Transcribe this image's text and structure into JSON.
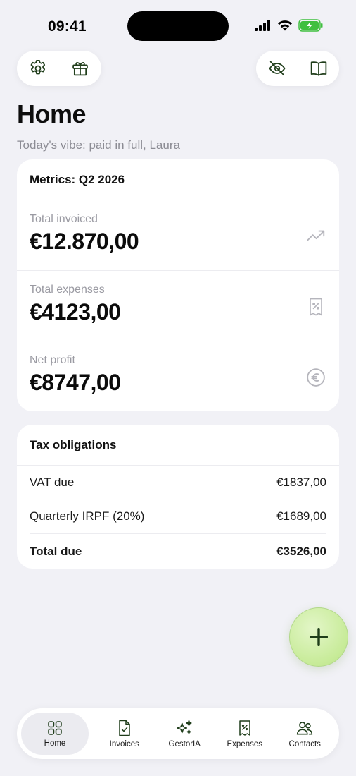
{
  "status_bar": {
    "time": "09:41"
  },
  "header": {
    "title": "Home",
    "subtitle": "Today's vibe: paid in full, Laura"
  },
  "icons": {
    "settings": "gear-icon",
    "gift": "gift-icon",
    "hide": "eye-off-icon",
    "guide": "book-open-icon"
  },
  "metrics": {
    "title": "Metrics: Q2 2026",
    "items": [
      {
        "label": "Total invoiced",
        "value": "€12.870,00",
        "icon": "trending-up-icon"
      },
      {
        "label": "Total expenses",
        "value": "€4123,00",
        "icon": "receipt-percent-icon"
      },
      {
        "label": "Net profit",
        "value": "€8747,00",
        "icon": "euro-circle-icon"
      }
    ]
  },
  "tax": {
    "title": "Tax obligations",
    "rows": [
      {
        "label": "VAT due",
        "value": "€1837,00"
      },
      {
        "label": "Quarterly IRPF (20%)",
        "value": "€1689,00"
      }
    ],
    "total": {
      "label": "Total due",
      "value": "€3526,00"
    }
  },
  "fab": {
    "icon": "plus-icon"
  },
  "tabbar": {
    "items": [
      {
        "label": "Home",
        "icon": "grid-icon",
        "active": true
      },
      {
        "label": "Invoices",
        "icon": "document-check-icon"
      },
      {
        "label": "GestorIA",
        "icon": "sparkles-icon"
      },
      {
        "label": "Expenses",
        "icon": "receipt-percent-icon"
      },
      {
        "label": "Contacts",
        "icon": "users-icon"
      }
    ]
  },
  "colors": {
    "background": "#f1f1f6",
    "card": "#ffffff",
    "accent": "#c7eb98",
    "accent_dark": "#1f3d1a",
    "muted_text": "#8c8c94"
  }
}
